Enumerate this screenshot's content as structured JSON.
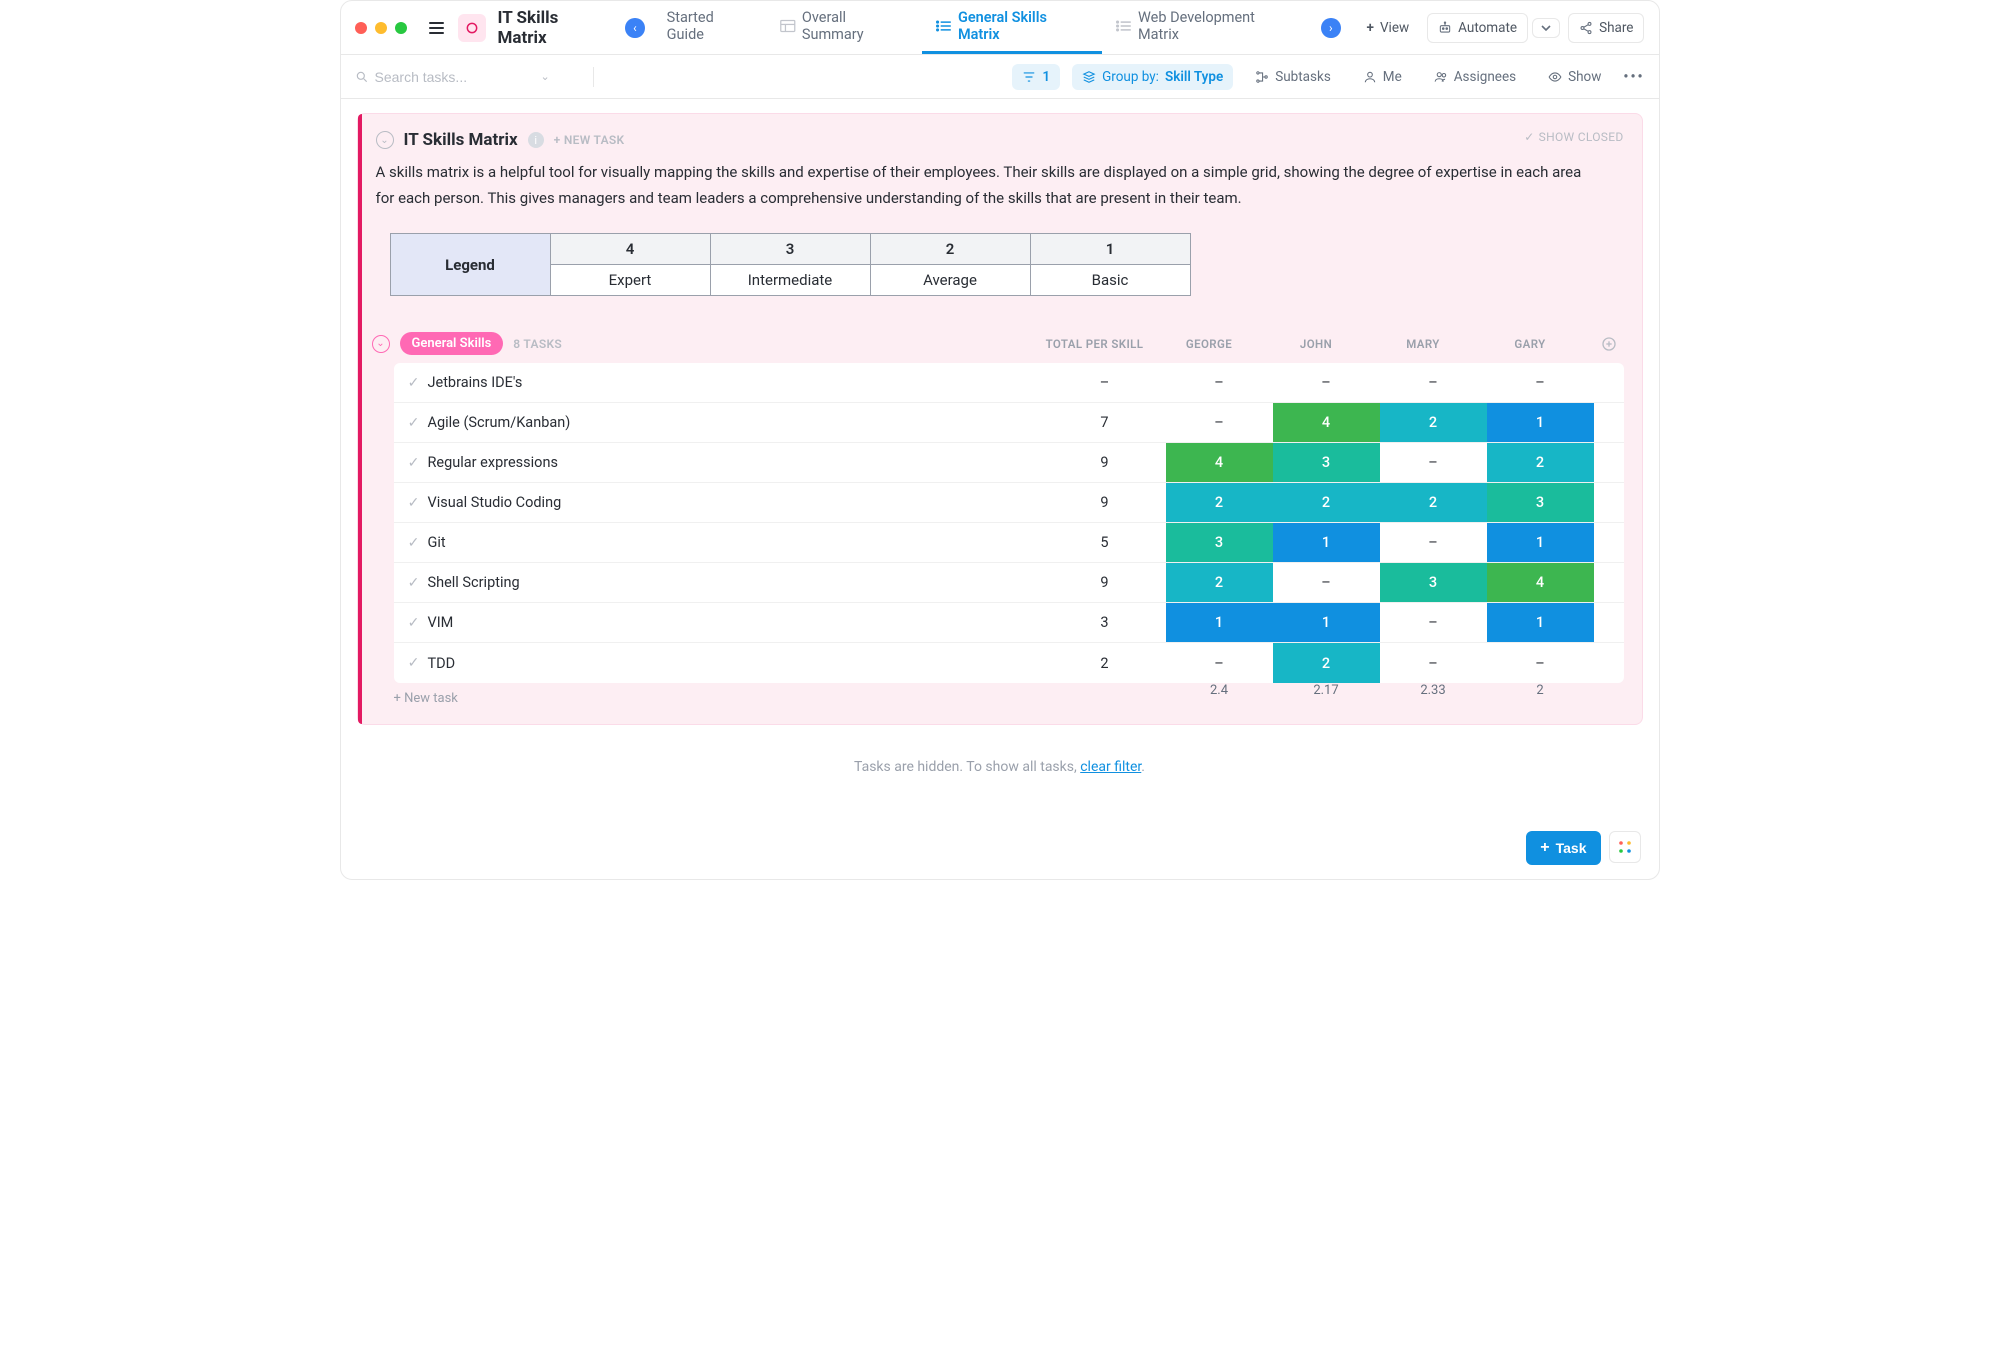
{
  "app": {
    "title": "IT Skills Matrix"
  },
  "tabs": [
    {
      "label": "Started Guide"
    },
    {
      "label": "Overall Summary"
    },
    {
      "label": "General Skills Matrix"
    },
    {
      "label": "Web Development Matrix"
    }
  ],
  "top_buttons": {
    "view": "View",
    "automate": "Automate",
    "share": "Share"
  },
  "toolbar": {
    "search_placeholder": "Search tasks...",
    "filter_count": "1",
    "group_label": "Group by:",
    "group_value": "Skill Type",
    "subtasks": "Subtasks",
    "me": "Me",
    "assignees": "Assignees",
    "show": "Show"
  },
  "block": {
    "title": "IT Skills Matrix",
    "new_task": "+ NEW TASK",
    "show_closed": "SHOW CLOSED",
    "desc": "A skills matrix is a helpful tool for visually mapping the skills and expertise of their employees. Their skills are displayed on a simple grid, showing the degree of expertise in each area for each person. This gives managers and team leaders a comprehensive understanding of the skills that are present in their team."
  },
  "legend": {
    "head": "Legend",
    "scores": [
      "4",
      "3",
      "2",
      "1"
    ],
    "labels": [
      "Expert",
      "Intermediate",
      "Average",
      "Basic"
    ]
  },
  "group": {
    "label": "General Skills",
    "count": "8 TASKS",
    "columns": {
      "total": "TOTAL PER SKILL",
      "p1": "GEORGE",
      "p2": "JOHN",
      "p3": "MARY",
      "p4": "GARY"
    }
  },
  "rows": [
    {
      "name": "Jetbrains IDE's",
      "total": "–",
      "v": [
        "–",
        "–",
        "–",
        "–"
      ]
    },
    {
      "name": "Agile (Scrum/Kanban)",
      "total": "7",
      "v": [
        "–",
        "4",
        "2",
        "1"
      ]
    },
    {
      "name": "Regular expressions",
      "total": "9",
      "v": [
        "4",
        "3",
        "–",
        "2"
      ]
    },
    {
      "name": "Visual Studio Coding",
      "total": "9",
      "v": [
        "2",
        "2",
        "2",
        "3"
      ]
    },
    {
      "name": "Git",
      "total": "5",
      "v": [
        "3",
        "1",
        "–",
        "1"
      ]
    },
    {
      "name": "Shell Scripting",
      "total": "9",
      "v": [
        "2",
        "–",
        "3",
        "4"
      ]
    },
    {
      "name": "VIM",
      "total": "3",
      "v": [
        "1",
        "1",
        "–",
        "1"
      ]
    },
    {
      "name": "TDD",
      "total": "2",
      "v": [
        "–",
        "2",
        "–",
        "–"
      ]
    }
  ],
  "averages": {
    "p1": "2.4",
    "p2": "2.17",
    "p3": "2.33",
    "p4": "2"
  },
  "footer": {
    "new_task": "+ New task"
  },
  "hidden_notice": {
    "text": "Tasks are hidden. To show all tasks, ",
    "link": "clear filter",
    "dot": "."
  },
  "fab": {
    "task": "Task"
  },
  "colors": {
    "accent": "#1090e0",
    "pink": "#ff69b4"
  }
}
